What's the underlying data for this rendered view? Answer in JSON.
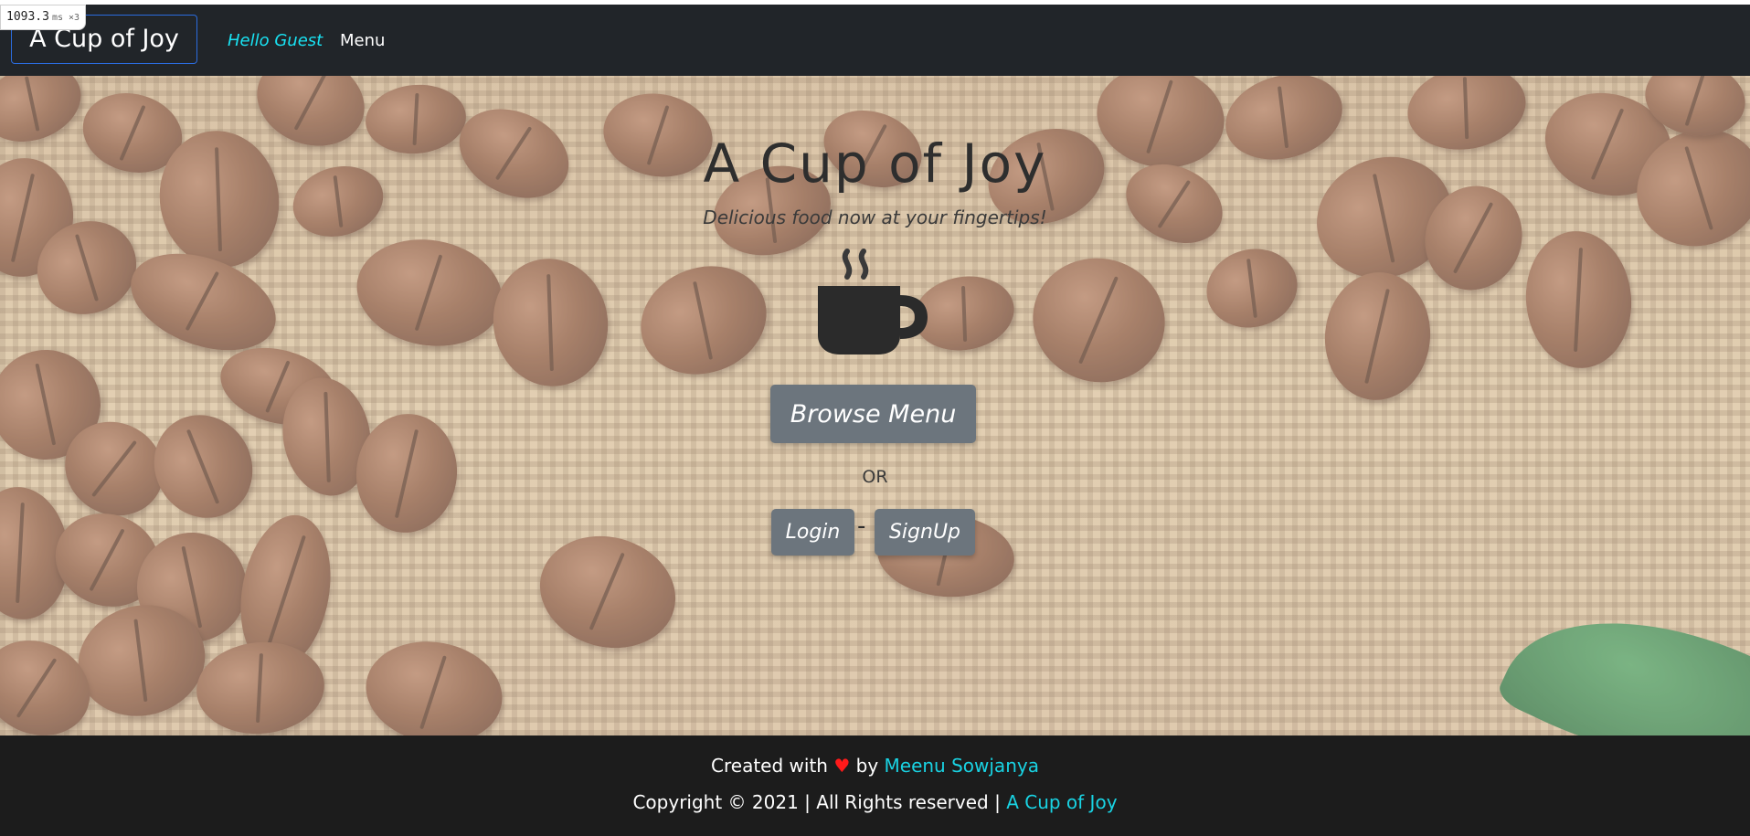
{
  "perf": {
    "value": "1093.3",
    "unit": "ms ×3"
  },
  "navbar": {
    "brand": "A Cup of Joy",
    "greeting": "Hello Guest",
    "menu_label": "Menu"
  },
  "hero": {
    "title": "A Cup of Joy",
    "tagline": "Delicious food now at your fingertips!",
    "icon": "coffee-cup-icon",
    "browse_label": "Browse Menu",
    "or_label": "OR",
    "login_label": "Login",
    "separator": "-",
    "signup_label": "SignUp"
  },
  "footer": {
    "created_prefix": "Created with",
    "heart": "♥",
    "created_by": "by",
    "author": "Meenu Sowjanya",
    "copyright": "Copyright © 2021 | All Rights reserved |",
    "site_link": "A Cup of Joy"
  },
  "colors": {
    "navbar_bg": "#212529",
    "accent_cyan": "#19e3f3",
    "button_bg": "#6c757d",
    "footer_bg": "#1c1c1c",
    "heart": "#ff1a1a"
  }
}
